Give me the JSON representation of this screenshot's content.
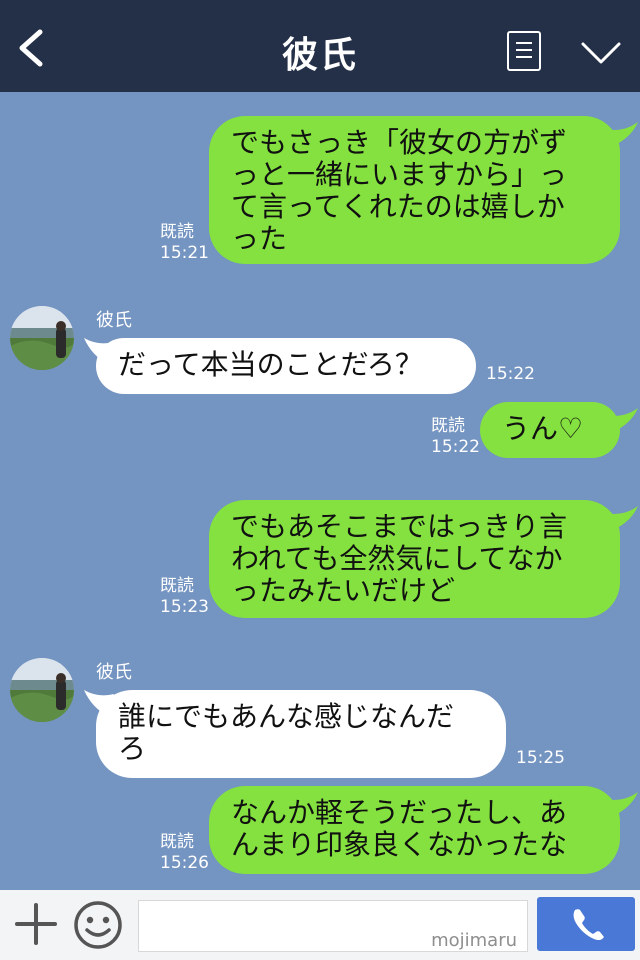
{
  "header": {
    "title": "彼氏",
    "icons": {
      "back": "chevron-left-icon",
      "menu": "menu-icon",
      "more": "chevron-down-icon"
    }
  },
  "contact": {
    "name": "彼氏"
  },
  "messages": [
    {
      "from": "me",
      "text": "でもさっき「彼女の方がずっと一緒にいますから」って言ってくれたのは嬉しかった",
      "lines": [
        "でもさっき「彼女の方がず",
        "っと一緒にいますから」っ",
        "て言ってくれたのは嬉しか",
        "った"
      ],
      "read": "既読",
      "time": "15:21"
    },
    {
      "from": "them",
      "sender": "彼氏",
      "text": "だって本当のことだろ？",
      "lines": [
        "だって本当のことだろ？"
      ],
      "time": "15:22"
    },
    {
      "from": "me",
      "text": "うん♡",
      "lines": [
        "うん♡"
      ],
      "read": "既読",
      "time": "15:22"
    },
    {
      "from": "me",
      "text": "でもあそこまではっきり言われても全然気にしてなかったみたいだけど",
      "lines": [
        "でもあそこまではっきり言",
        "われても全然気にしてなか",
        "ったみたいだけど"
      ],
      "read": "既読",
      "time": "15:23"
    },
    {
      "from": "them",
      "sender": "彼氏",
      "text": "誰にでもあんな感じなんだろ",
      "lines": [
        "誰にでもあんな感じなんだ",
        "ろ"
      ],
      "time": "15:25"
    },
    {
      "from": "me",
      "text": "なんか軽そうだったし、あんまり印象良くなかったな",
      "lines": [
        "なんか軽そうだったし、あ",
        "んまり印象良くなかったな"
      ],
      "read": "既読",
      "time": "15:26"
    }
  ],
  "input_bar": {
    "watermark": "mojimaru",
    "icons": {
      "add": "plus-icon",
      "emoji": "smiley-icon",
      "call": "phone-icon"
    }
  },
  "colors": {
    "header_bg": "#243048",
    "chat_bg": "#7494c1",
    "my_bubble": "#84e13f",
    "their_bubble": "#ffffff",
    "send_button": "#4a78d6"
  }
}
